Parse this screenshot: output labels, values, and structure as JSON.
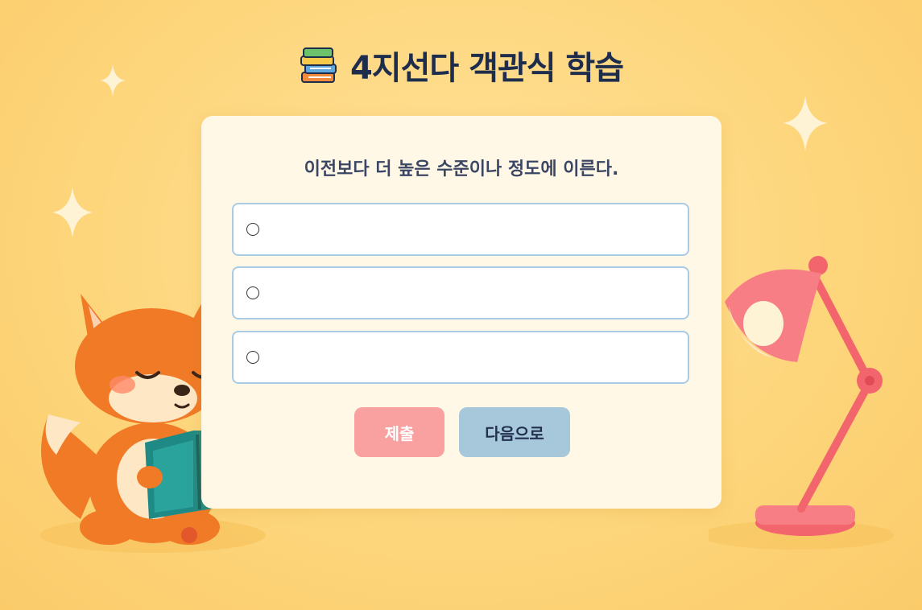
{
  "app": {
    "title": "4지선다 객관식 학습",
    "title_icon": "books-icon"
  },
  "quiz": {
    "question": "이전보다 더 높은 수준이나 정도에 이른다.",
    "options": [
      {
        "label": ""
      },
      {
        "label": ""
      },
      {
        "label": ""
      }
    ],
    "submit_label": "제출",
    "next_label": "다음으로"
  },
  "decor": {
    "mascot": "fox-reading-book",
    "lamp": "desk-lamp-icon",
    "sparkles": "sparkle-icon"
  },
  "colors": {
    "background": "#fdd57a",
    "card": "#fff8e6",
    "option_border": "#a9cbe4",
    "submit_button": "#f9a1a0",
    "next_button": "#a7c7db",
    "title": "#1f2d4d"
  }
}
